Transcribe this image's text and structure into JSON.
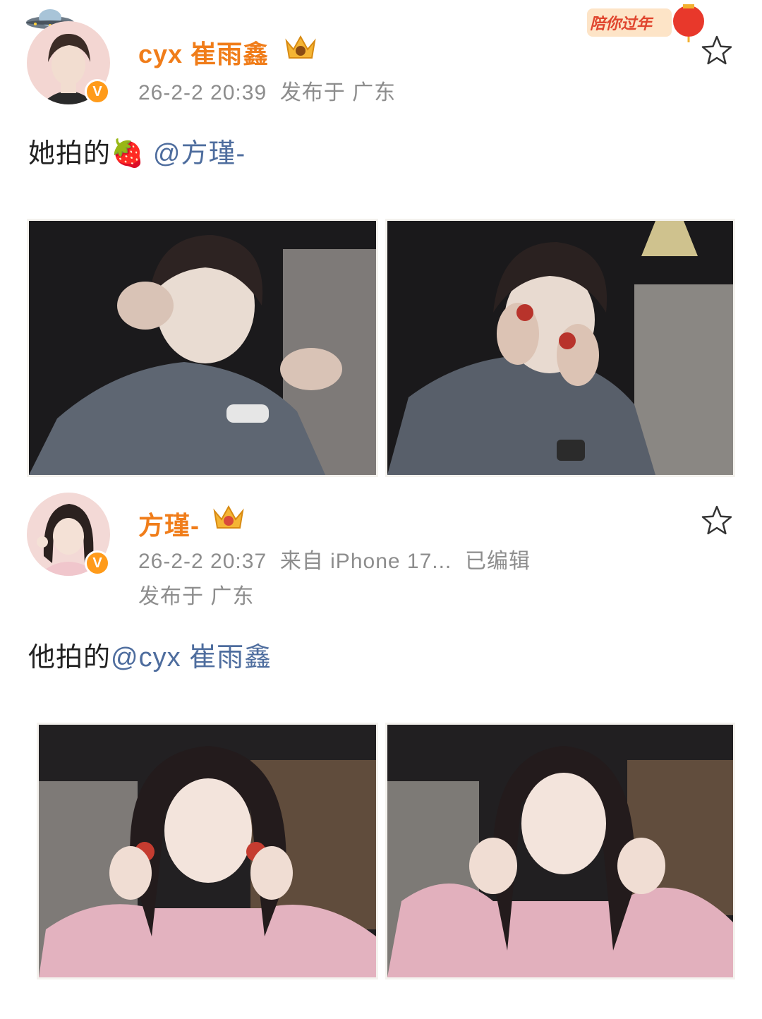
{
  "post1": {
    "username": "cyx 崔雨鑫",
    "timestamp": "26-2-2 20:39",
    "location": "发布于 广东",
    "text_prefix": "她拍的",
    "text_emoji": "🍓",
    "mention": "@方瑾-",
    "festive_badge": "陪你过年",
    "verified_badge": "V",
    "icons": [
      "ufo-icon",
      "crown-vip-icon",
      "star-icon",
      "lantern-icon",
      "strawberry-emoji"
    ]
  },
  "post2": {
    "username": "方瑾-",
    "timestamp": "26-2-2 20:37",
    "source": "来自 iPhone 17...",
    "edited": "已编辑",
    "location": "发布于 广东",
    "text_prefix": "他拍的",
    "mention": "@cyx 崔雨鑫",
    "verified_badge": "V",
    "icons": [
      "crown-vip-icon",
      "star-icon"
    ]
  },
  "colors": {
    "username": "#f07d1a",
    "mention": "#4e6d9e",
    "meta": "#8d8d8d",
    "badge": "#ff9b1a"
  }
}
